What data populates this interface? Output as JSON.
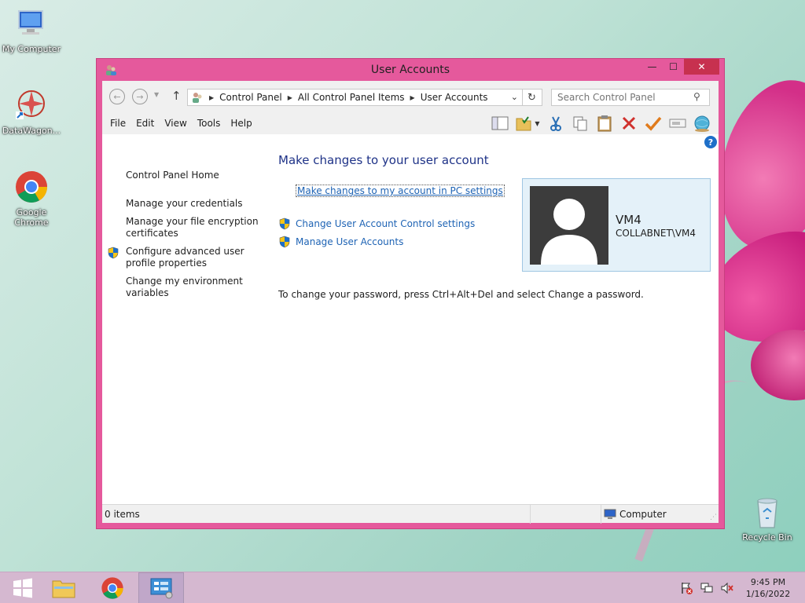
{
  "desktop": {
    "icons": [
      {
        "label": "My Computer"
      },
      {
        "label": "DataWagon..."
      },
      {
        "label": "Google Chrome"
      },
      {
        "label": "Recycle Bin"
      }
    ]
  },
  "window": {
    "title": "User Accounts",
    "buttons": {
      "minimize": "—",
      "maximize": "☐",
      "close": "✕"
    }
  },
  "address_bar": {
    "breadcrumbs": [
      "Control Panel",
      "All Control Panel Items",
      "User Accounts"
    ],
    "search_placeholder": "Search Control Panel"
  },
  "menu": {
    "items": [
      "File",
      "Edit",
      "View",
      "Tools",
      "Help"
    ]
  },
  "left_pane": {
    "home": "Control Panel Home",
    "links": [
      "Manage your credentials",
      "Manage your file encryption certificates",
      "Configure advanced user profile properties",
      "Change my environment variables"
    ]
  },
  "main": {
    "title": "Make changes to your user account",
    "pc_settings_link": "Make changes to my account in PC settings",
    "uac_link": "Change User Account Control settings",
    "manage_link": "Manage User Accounts",
    "password_note": "To change your password, press Ctrl+Alt+Del and select Change a password."
  },
  "user": {
    "name": "VM4",
    "domain": "COLLABNET\\VM4"
  },
  "statusbar": {
    "items": "0 items",
    "zone": "Computer"
  },
  "taskbar": {
    "time": "9:45 PM",
    "date": "1/16/2022"
  },
  "colors": {
    "window_frame": "#e5599c",
    "close_button": "#c7314f",
    "link": "#1e63b4",
    "heading": "#1e3287"
  }
}
